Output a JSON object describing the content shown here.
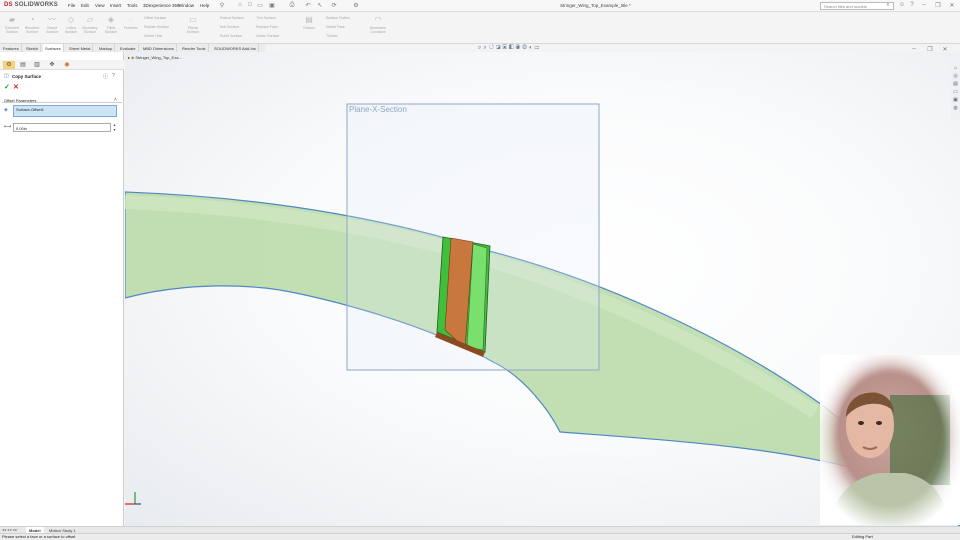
{
  "app": {
    "logo_prefix": "DS",
    "logo_text": "SOLIDWORKS"
  },
  "menu": [
    "File",
    "Edit",
    "View",
    "Insert",
    "Tools",
    "3Dexperience 360",
    "Window",
    "Help"
  ],
  "document_title": "Stringer_Wing_Top_Example_title *",
  "search": {
    "placeholder": "Search files and models"
  },
  "command_manager": {
    "big_buttons": [
      "Extruded Surface",
      "Revolved Surface",
      "Swept Surface",
      "Lofted Surface",
      "Boundary Surface",
      "Filled Surface",
      "Freeform",
      "Planar Surface"
    ],
    "rows": [
      [
        "Offset Surface",
        "Ruled Surface",
        "Surface Flatten"
      ],
      [
        "Radiate Surface",
        "Knit Surface",
        "Delete Face"
      ],
      [
        "Delete Hole",
        "Replace Face",
        "Untrim Surface"
      ],
      [
        "Extend Surface",
        "Trim Surface",
        "Thicken"
      ]
    ],
    "right_buttons": [
      "Thicken",
      "Thickened Cut",
      "Cut With Surface",
      "Dimension Curvature"
    ]
  },
  "tabs": [
    "Features",
    "Sketch",
    "Surfaces",
    "Sheet Metal",
    "Markup",
    "Evaluate",
    "MBD Dimensions",
    "Render Tools",
    "SOLIDWORKS Add-Ins"
  ],
  "active_tab": "Surfaces",
  "tree_path": "Stringer_Wing_Top_Exa...",
  "property_manager": {
    "title": "Copy Surface",
    "section_label": "Offset Parameters",
    "selection_value": "Surface-Offset1",
    "distance_value": "0.00in"
  },
  "viewport": {
    "plane_label": "Plane-X-Section",
    "colors": {
      "wing": "#b7d9a6",
      "wing_edge": "#4f86c6",
      "section_orange": "#c8783c",
      "section_green": "#3fbf3a",
      "plane_border": "#8fa6c7"
    }
  },
  "bottom_tabs": [
    "Model",
    "Motion Study 1"
  ],
  "active_bottom_tab": "Model",
  "status": {
    "left": "Please select a face or a surface to offset",
    "right": "Editing Part"
  },
  "icons": [
    "search-icon",
    "help-icon",
    "user-icon",
    "minimize-icon",
    "restore-icon",
    "close-icon",
    "ok-check-icon",
    "cancel-x-icon",
    "pushpin-icon",
    "info-icon",
    "surface-face-icon",
    "distance-icon",
    "triad-icon"
  ]
}
